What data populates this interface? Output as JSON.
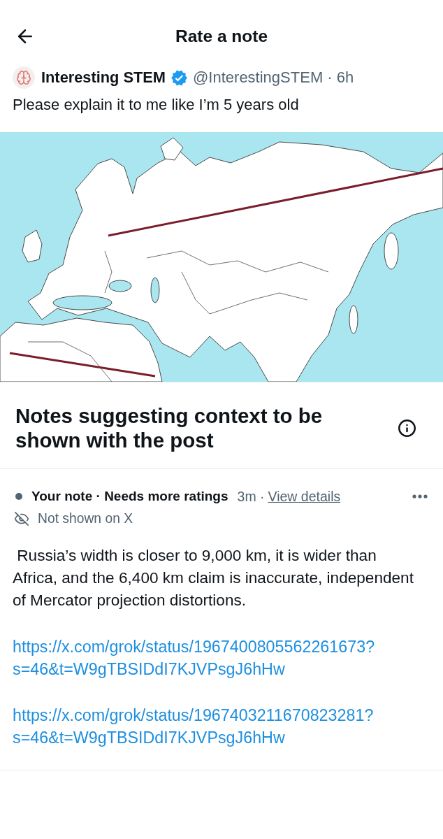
{
  "header": {
    "title": "Rate a note"
  },
  "post": {
    "author": {
      "name": "Interesting STEM",
      "verified": true,
      "meta": "@InterestingSTEM · 6h"
    },
    "text": "Please explain it to me like I’m 5 years old",
    "media": {
      "kind": "map"
    }
  },
  "notes_section": {
    "title": "Notes suggesting context to be shown with the post"
  },
  "notes": [
    {
      "label": "Your note · Needs more ratings",
      "time": "3m ·",
      "details_link": "View details",
      "visibility": "Not shown on X",
      "text": " Russia’s width is closer to 9,000 km, it is wider than Africa, and the 6,400 km claim is inaccurate, independent of Mercator projection distortions.",
      "links": [
        "https://x.com/grok/status/1967400805562261673?s=46&t=W9gTBSIDdI7KJVPsgJ6hHw",
        "https://x.com/grok/status/1967403211670823281?s=46&t=W9gTBSIDdI7KJVPsgJ6hHw"
      ]
    }
  ]
}
